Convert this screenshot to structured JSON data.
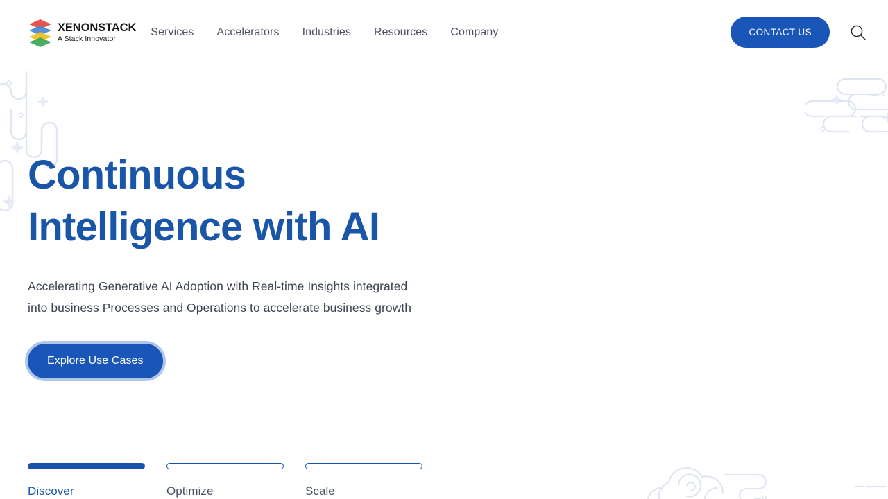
{
  "brand": {
    "name": "XENONSTACK",
    "tagline": "A Stack Innovator",
    "logo_icon": "stacked-layers-icon",
    "logo_colors": [
      "#e2483a",
      "#4a86d8",
      "#f0c020",
      "#3aa856"
    ]
  },
  "nav": {
    "items": [
      {
        "label": "Services"
      },
      {
        "label": "Accelerators"
      },
      {
        "label": "Industries"
      },
      {
        "label": "Resources"
      },
      {
        "label": "Company"
      }
    ]
  },
  "header": {
    "contact_label": "CONTACT US",
    "search_icon": "search-icon",
    "accent_color": "#1a56b8"
  },
  "hero": {
    "title_line_1": "Continuous",
    "title_line_2": "Intelligence with AI",
    "title_color": "#1a56a8",
    "subtitle_line_1": "Accelerating Generative AI Adoption with Real-time Insights",
    "subtitle_line_2": "integrated into business Processes and Operations to",
    "subtitle_line_3": "accelerate business growth",
    "cta_label": "Explore Use Cases"
  },
  "steps": {
    "items": [
      {
        "label": "Discover",
        "active": true
      },
      {
        "label": "Optimize",
        "active": false
      },
      {
        "label": "Scale",
        "active": false
      }
    ]
  },
  "decor": {
    "pattern_color": "#dfe5f1",
    "top_left": "rounded-line-pattern",
    "top_right": "rounded-line-pattern",
    "bottom_right": "cloud-spiral-pattern"
  }
}
